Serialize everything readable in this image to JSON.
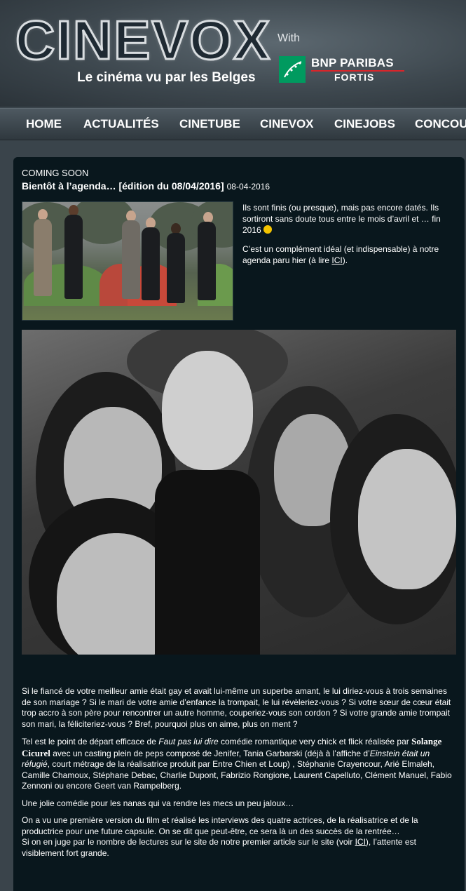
{
  "header": {
    "logo_text": "CINEVOX",
    "tagline": "Le cinéma vu par les Belges",
    "sponsor_prefix": "With",
    "sponsor_name_line1": "BNP PARIBAS",
    "sponsor_name_line2": "FORTIS"
  },
  "nav": {
    "items": [
      {
        "label": "HOME"
      },
      {
        "label": "ACTUALITÉS"
      },
      {
        "label": "CINETUBE"
      },
      {
        "label": "CINEVOX"
      },
      {
        "label": "CINEJOBS"
      },
      {
        "label": "CONCOU"
      }
    ]
  },
  "article": {
    "category": "COMING SOON",
    "title": "Bientôt à l’agenda… [édition du 08/04/2016]",
    "date": "08-04-2016",
    "intro": {
      "p1": "Ils sont finis (ou presque), mais pas encore datés. Ils sortiront sans doute tous entre le mois d’avril et … fin 2016",
      "p2_before": "C’est un complément idéal (et indispensable) à notre agenda paru hier (à lire ",
      "p2_link": "ICI",
      "p2_after": ")."
    },
    "body": {
      "p1": "Si le fiancé de votre meilleur amie était gay et avait lui-même un superbe amant, le lui diriez-vous à trois semaines de son mariage ? Si le mari de votre amie d’enfance la trompait, le lui révèleriez-vous ? Si votre sœur de cœur était trop accro à son père pour rencontrer un autre homme, couperiez-vous son cordon ? Si votre grande amie trompait son mari, la féliciteriez-vous ? Bref, pourquoi plus on aime, plus on ment ?",
      "p2_a": "Tel est le point de départ efficace de ",
      "p2_film": "Faut pas lui dire",
      "p2_b": " comédie romantique very chick et flick réalisée  par ",
      "p2_director": "Solange Cicurel",
      "p2_c": " avec un casting plein de peps composé de Jenifer, Tania Garbarski (déjà à l’affiche d’",
      "p2_short": "Einstein était un réfugié",
      "p2_d": ", court métrage de la réalisatrice produit par Entre Chien et Loup) , Stéphanie Crayencour, Arié Elmaleh, Camille Chamoux, Stéphane Debac, Charlie Dupont, Fabrizio Rongione, Laurent Capelluto, Clément Manuel, Fabio Zennoni ou encore Geert van Rampelberg.",
      "p3": "Une jolie comédie pour les nanas qui va rendre les mecs un peu jaloux…",
      "p4_a": "On a vu une première version du film et réalisé les interviews des quatre actrices, de la réalisatrice et de la productrice pour une future capsule. On se dit que peut-être, ce sera là un des succès de la rentrée…",
      "p4_b": "Si on en juge par le nombre de lectures sur le site de notre premier article sur le site (voir ",
      "p4_link": "ICI",
      "p4_c": "), l’attente est visiblement fort grande."
    }
  }
}
